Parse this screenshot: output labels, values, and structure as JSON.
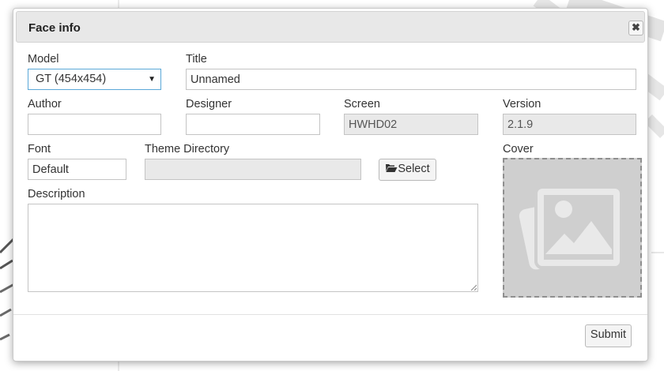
{
  "dialog": {
    "title": "Face info",
    "close_symbol": "✖",
    "close_icon": "close-icon"
  },
  "fields": {
    "model": {
      "label": "Model",
      "value": "GT (454x454)"
    },
    "title": {
      "label": "Title",
      "value": "Unnamed"
    },
    "author": {
      "label": "Author",
      "value": ""
    },
    "designer": {
      "label": "Designer",
      "value": ""
    },
    "screen": {
      "label": "Screen",
      "value": "HWHD02"
    },
    "version": {
      "label": "Version",
      "value": "2.1.9"
    },
    "font": {
      "label": "Font",
      "value": "Default"
    },
    "theme_directory": {
      "label": "Theme Directory",
      "value": ""
    },
    "description": {
      "label": "Description",
      "value": ""
    },
    "cover": {
      "label": "Cover",
      "icon": "image-placeholder-icon"
    }
  },
  "buttons": {
    "select": {
      "label": "Select",
      "icon": "folder-open-icon"
    },
    "submit": {
      "label": "Submit"
    }
  },
  "colors": {
    "header_bg": "#e8e8e8",
    "readonly_bg": "#e9e9e9",
    "focus_border": "#5aa8d8",
    "cover_bg": "#cfcfcf"
  }
}
